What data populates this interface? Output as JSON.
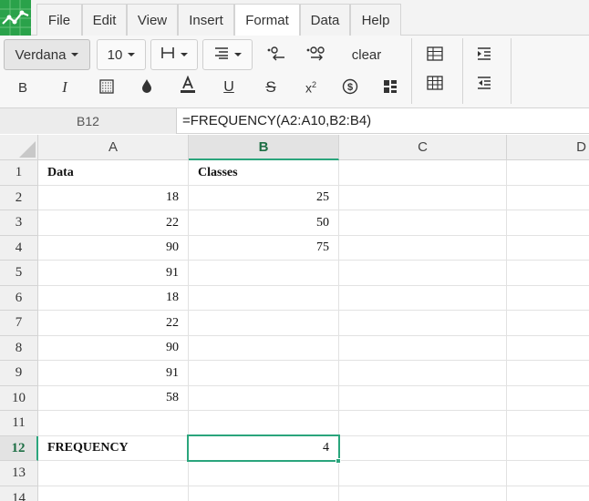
{
  "menu": {
    "items": [
      {
        "id": "file",
        "label": "File"
      },
      {
        "id": "edit",
        "label": "Edit"
      },
      {
        "id": "view",
        "label": "View"
      },
      {
        "id": "insert",
        "label": "Insert"
      },
      {
        "id": "format",
        "label": "Format",
        "active": true
      },
      {
        "id": "data",
        "label": "Data"
      },
      {
        "id": "help",
        "label": "Help"
      }
    ]
  },
  "toolbar": {
    "font_family": "Verdana",
    "font_size": "10",
    "clear_label": "clear",
    "icons": [
      "borders-icon",
      "align-icon",
      "decrease-decimals-icon",
      "increase-decimals-icon",
      "insert-table-icon",
      "table-icon",
      "indent-icon",
      "outdent-icon",
      "bold-icon",
      "italic-icon",
      "background-pattern-icon",
      "fill-color-icon",
      "text-color-icon",
      "underline-icon",
      "strikethrough-icon",
      "superscript-icon",
      "currency-icon",
      "table-format-icon"
    ]
  },
  "formula_bar": {
    "cell_ref": "B12",
    "formula": "=FREQUENCY(A2:A10,B2:B4)"
  },
  "sheet": {
    "columns": [
      "A",
      "B",
      "C",
      "D"
    ],
    "selected_column": "B",
    "selected_row": "12",
    "rows": [
      {
        "n": "1",
        "a": "Data",
        "b": "Classes",
        "bold": true
      },
      {
        "n": "2",
        "a": "18",
        "b": "25"
      },
      {
        "n": "3",
        "a": "22",
        "b": "50"
      },
      {
        "n": "4",
        "a": "90",
        "b": "75"
      },
      {
        "n": "5",
        "a": "91",
        "b": ""
      },
      {
        "n": "6",
        "a": "18",
        "b": ""
      },
      {
        "n": "7",
        "a": "22",
        "b": ""
      },
      {
        "n": "8",
        "a": "90",
        "b": ""
      },
      {
        "n": "9",
        "a": "91",
        "b": ""
      },
      {
        "n": "10",
        "a": "58",
        "b": ""
      },
      {
        "n": "11",
        "a": "",
        "b": ""
      },
      {
        "n": "12",
        "a": "FREQUENCY",
        "b": "4",
        "bold_a": true
      },
      {
        "n": "13",
        "a": "",
        "b": ""
      },
      {
        "n": "14",
        "a": "",
        "b": ""
      }
    ]
  },
  "colors": {
    "accent": "#2aa57c",
    "logo": "#2aa24a"
  }
}
